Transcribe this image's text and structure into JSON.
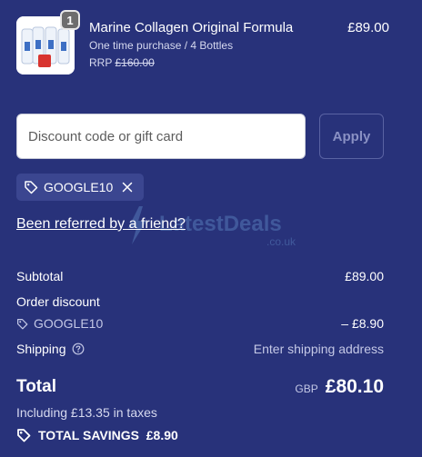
{
  "product": {
    "quantity": "1",
    "name": "Marine Collagen Original Formula",
    "subtitle": "One time purchase / 4 Bottles",
    "rrp_label": "RRP",
    "rrp_value": "£160.00",
    "price": "£89.00"
  },
  "discount": {
    "placeholder": "Discount code or gift card",
    "apply_label": "Apply",
    "applied_code": "GOOGLE10"
  },
  "referral_link": "Been referred by a friend?",
  "watermark": {
    "text": "LatestDeals",
    "sub": ".co.uk"
  },
  "summary": {
    "subtotal_label": "Subtotal",
    "subtotal_value": "£89.00",
    "order_discount_label": "Order discount",
    "discount_code": "GOOGLE10",
    "discount_value": "– £8.90",
    "shipping_label": "Shipping",
    "shipping_value": "Enter shipping address",
    "total_label": "Total",
    "total_currency": "GBP",
    "total_value": "£80.10",
    "taxes_text": "Including £13.35 in taxes",
    "savings_text": "TOTAL SAVINGS  £8.90"
  },
  "colors": {
    "background": "#28327a",
    "chip": "#3b4690",
    "text": "#ffffff"
  }
}
